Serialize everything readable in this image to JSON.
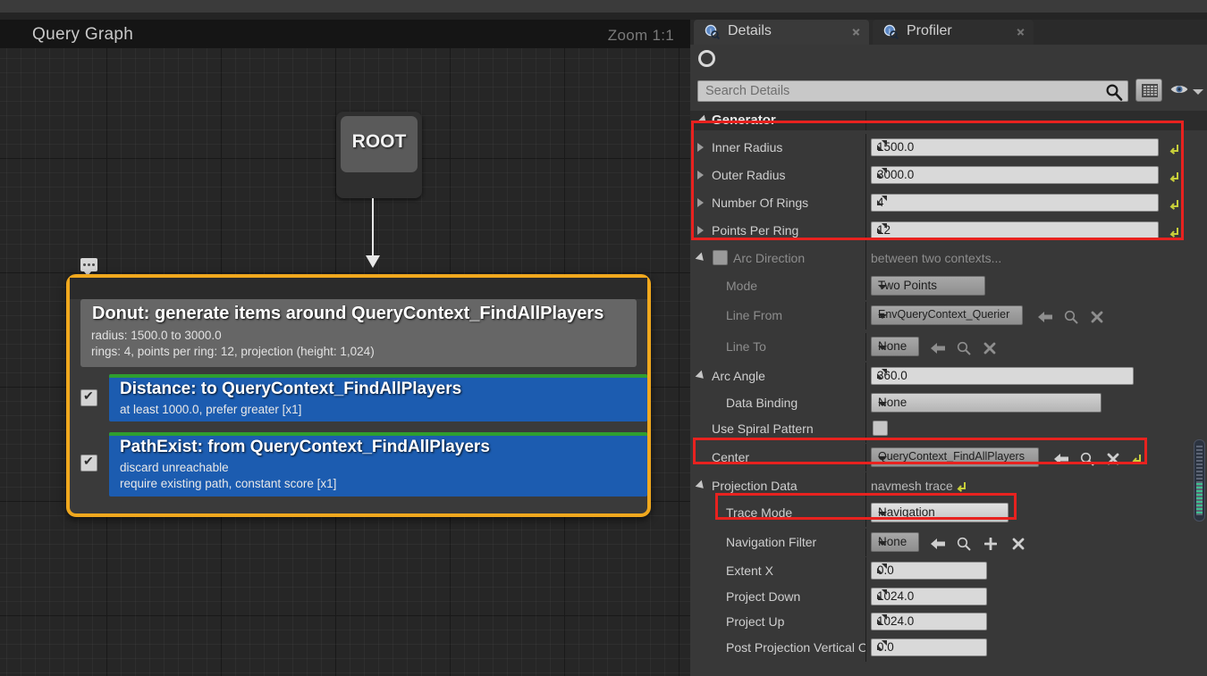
{
  "graph": {
    "title": "Query Graph",
    "zoom_label": "Zoom 1:1",
    "root_node": {
      "label": "ROOT"
    },
    "comment_icon": "comment-bubble-icon",
    "generator_node": {
      "title": "Donut: generate items around QueryContext_FindAllPlayers",
      "detail_line_1": "radius: 1500.0 to 3000.0",
      "detail_line_2": "rings: 4, points per ring: 12, projection (height: 1,024)",
      "border_color": "#f0a81e",
      "tests": [
        {
          "checked": true,
          "title": "Distance: to QueryContext_FindAllPlayers",
          "lines": [
            "at least 1000.0, prefer greater [x1]"
          ],
          "accent_color": "#2f9e2f",
          "body_color": "#1c5cb0"
        },
        {
          "checked": true,
          "title": "PathExist: from QueryContext_FindAllPlayers",
          "lines": [
            "discard unreachable",
            "require existing path, constant score [x1]"
          ],
          "accent_color": "#2f9e2f",
          "body_color": "#1c5cb0"
        }
      ]
    }
  },
  "details": {
    "tabs": [
      {
        "label": "Details",
        "active": true,
        "icon": "info-magnifier-icon"
      },
      {
        "label": "Profiler",
        "active": false,
        "icon": "info-magnifier-icon"
      }
    ],
    "toolbar": {
      "circle_icon": "circle-icon",
      "search_placeholder": "Search Details",
      "search_value": "",
      "search_icon": "search-icon",
      "grid_view_icon": "grid-view-icon",
      "eye_icon": "eye-icon",
      "caret_icon": "chevron-down-icon"
    },
    "category": {
      "label": "Generator",
      "expanded": true
    },
    "properties": [
      {
        "label": "Inner Radius",
        "type": "number",
        "value": "1500.0",
        "expander": "collapsed",
        "reset": true,
        "indent": 0,
        "dim": false
      },
      {
        "label": "Outer Radius",
        "type": "number",
        "value": "3000.0",
        "expander": "collapsed",
        "reset": true,
        "indent": 0,
        "dim": false
      },
      {
        "label": "Number Of Rings",
        "type": "number",
        "value": "4",
        "expander": "collapsed",
        "reset": true,
        "indent": 0,
        "dim": false
      },
      {
        "label": "Points Per Ring",
        "type": "number",
        "value": "12",
        "expander": "collapsed",
        "reset": true,
        "indent": 0,
        "dim": false
      },
      {
        "label": "Arc Direction",
        "type": "static-checkbox",
        "value": "between two contexts...",
        "expander": "expanded",
        "checkbox": false,
        "indent": 0,
        "dim": true
      },
      {
        "label": "Mode",
        "type": "combo",
        "value": "Two Points",
        "indent": 1,
        "dim": true
      },
      {
        "label": "Line From",
        "type": "object",
        "value": "EnvQueryContext_Querier",
        "indent": 1,
        "dim": true,
        "actions": [
          "back-arrow-icon",
          "browse-icon",
          "clear-icon"
        ]
      },
      {
        "label": "Line To",
        "type": "object",
        "value": "None",
        "indent": 1,
        "dim": true,
        "actions": [
          "back-arrow-icon",
          "browse-icon",
          "clear-icon"
        ]
      },
      {
        "label": "Arc Angle",
        "type": "number",
        "value": "360.0",
        "expander": "expanded",
        "indent": 0,
        "dim": false
      },
      {
        "label": "Data Binding",
        "type": "combo-wide",
        "value": "None",
        "indent": 1,
        "dim": false
      },
      {
        "label": "Use Spiral Pattern",
        "type": "checkbox",
        "value": false,
        "indent": 0,
        "dim": false
      },
      {
        "label": "Center",
        "type": "object",
        "value": "QueryContext_FindAllPlayers",
        "indent": 0,
        "dim": false,
        "actions": [
          "back-arrow-icon",
          "browse-icon",
          "clear-icon",
          "reset-icon"
        ]
      },
      {
        "label": "Projection Data",
        "type": "static",
        "value": "navmesh trace",
        "expander": "expanded",
        "reset": true,
        "indent": 0,
        "dim": false
      },
      {
        "label": "Trace Mode",
        "type": "combo",
        "value": "Navigation",
        "indent": 1,
        "dim": false
      },
      {
        "label": "Navigation Filter",
        "type": "object",
        "value": "None",
        "indent": 1,
        "dim": false,
        "actions": [
          "back-arrow-icon",
          "browse-icon",
          "add-icon",
          "clear-icon"
        ]
      },
      {
        "label": "Extent X",
        "type": "number",
        "value": "0.0",
        "indent": 1,
        "dim": false
      },
      {
        "label": "Project Down",
        "type": "number",
        "value": "1024.0",
        "indent": 1,
        "dim": false
      },
      {
        "label": "Project Up",
        "type": "number",
        "value": "1024.0",
        "indent": 1,
        "dim": false
      },
      {
        "label": "Post Projection Vertical Offs",
        "type": "number",
        "value": "0.0",
        "indent": 1,
        "dim": false
      }
    ],
    "highlights": [
      {
        "name": "generator-params-highlight",
        "color": "#e8221f"
      },
      {
        "name": "center-highlight",
        "color": "#e8221f"
      },
      {
        "name": "trace-mode-highlight",
        "color": "#e8221f"
      }
    ],
    "scrollbar": {
      "name": "details-vertical-scrollbar"
    }
  }
}
